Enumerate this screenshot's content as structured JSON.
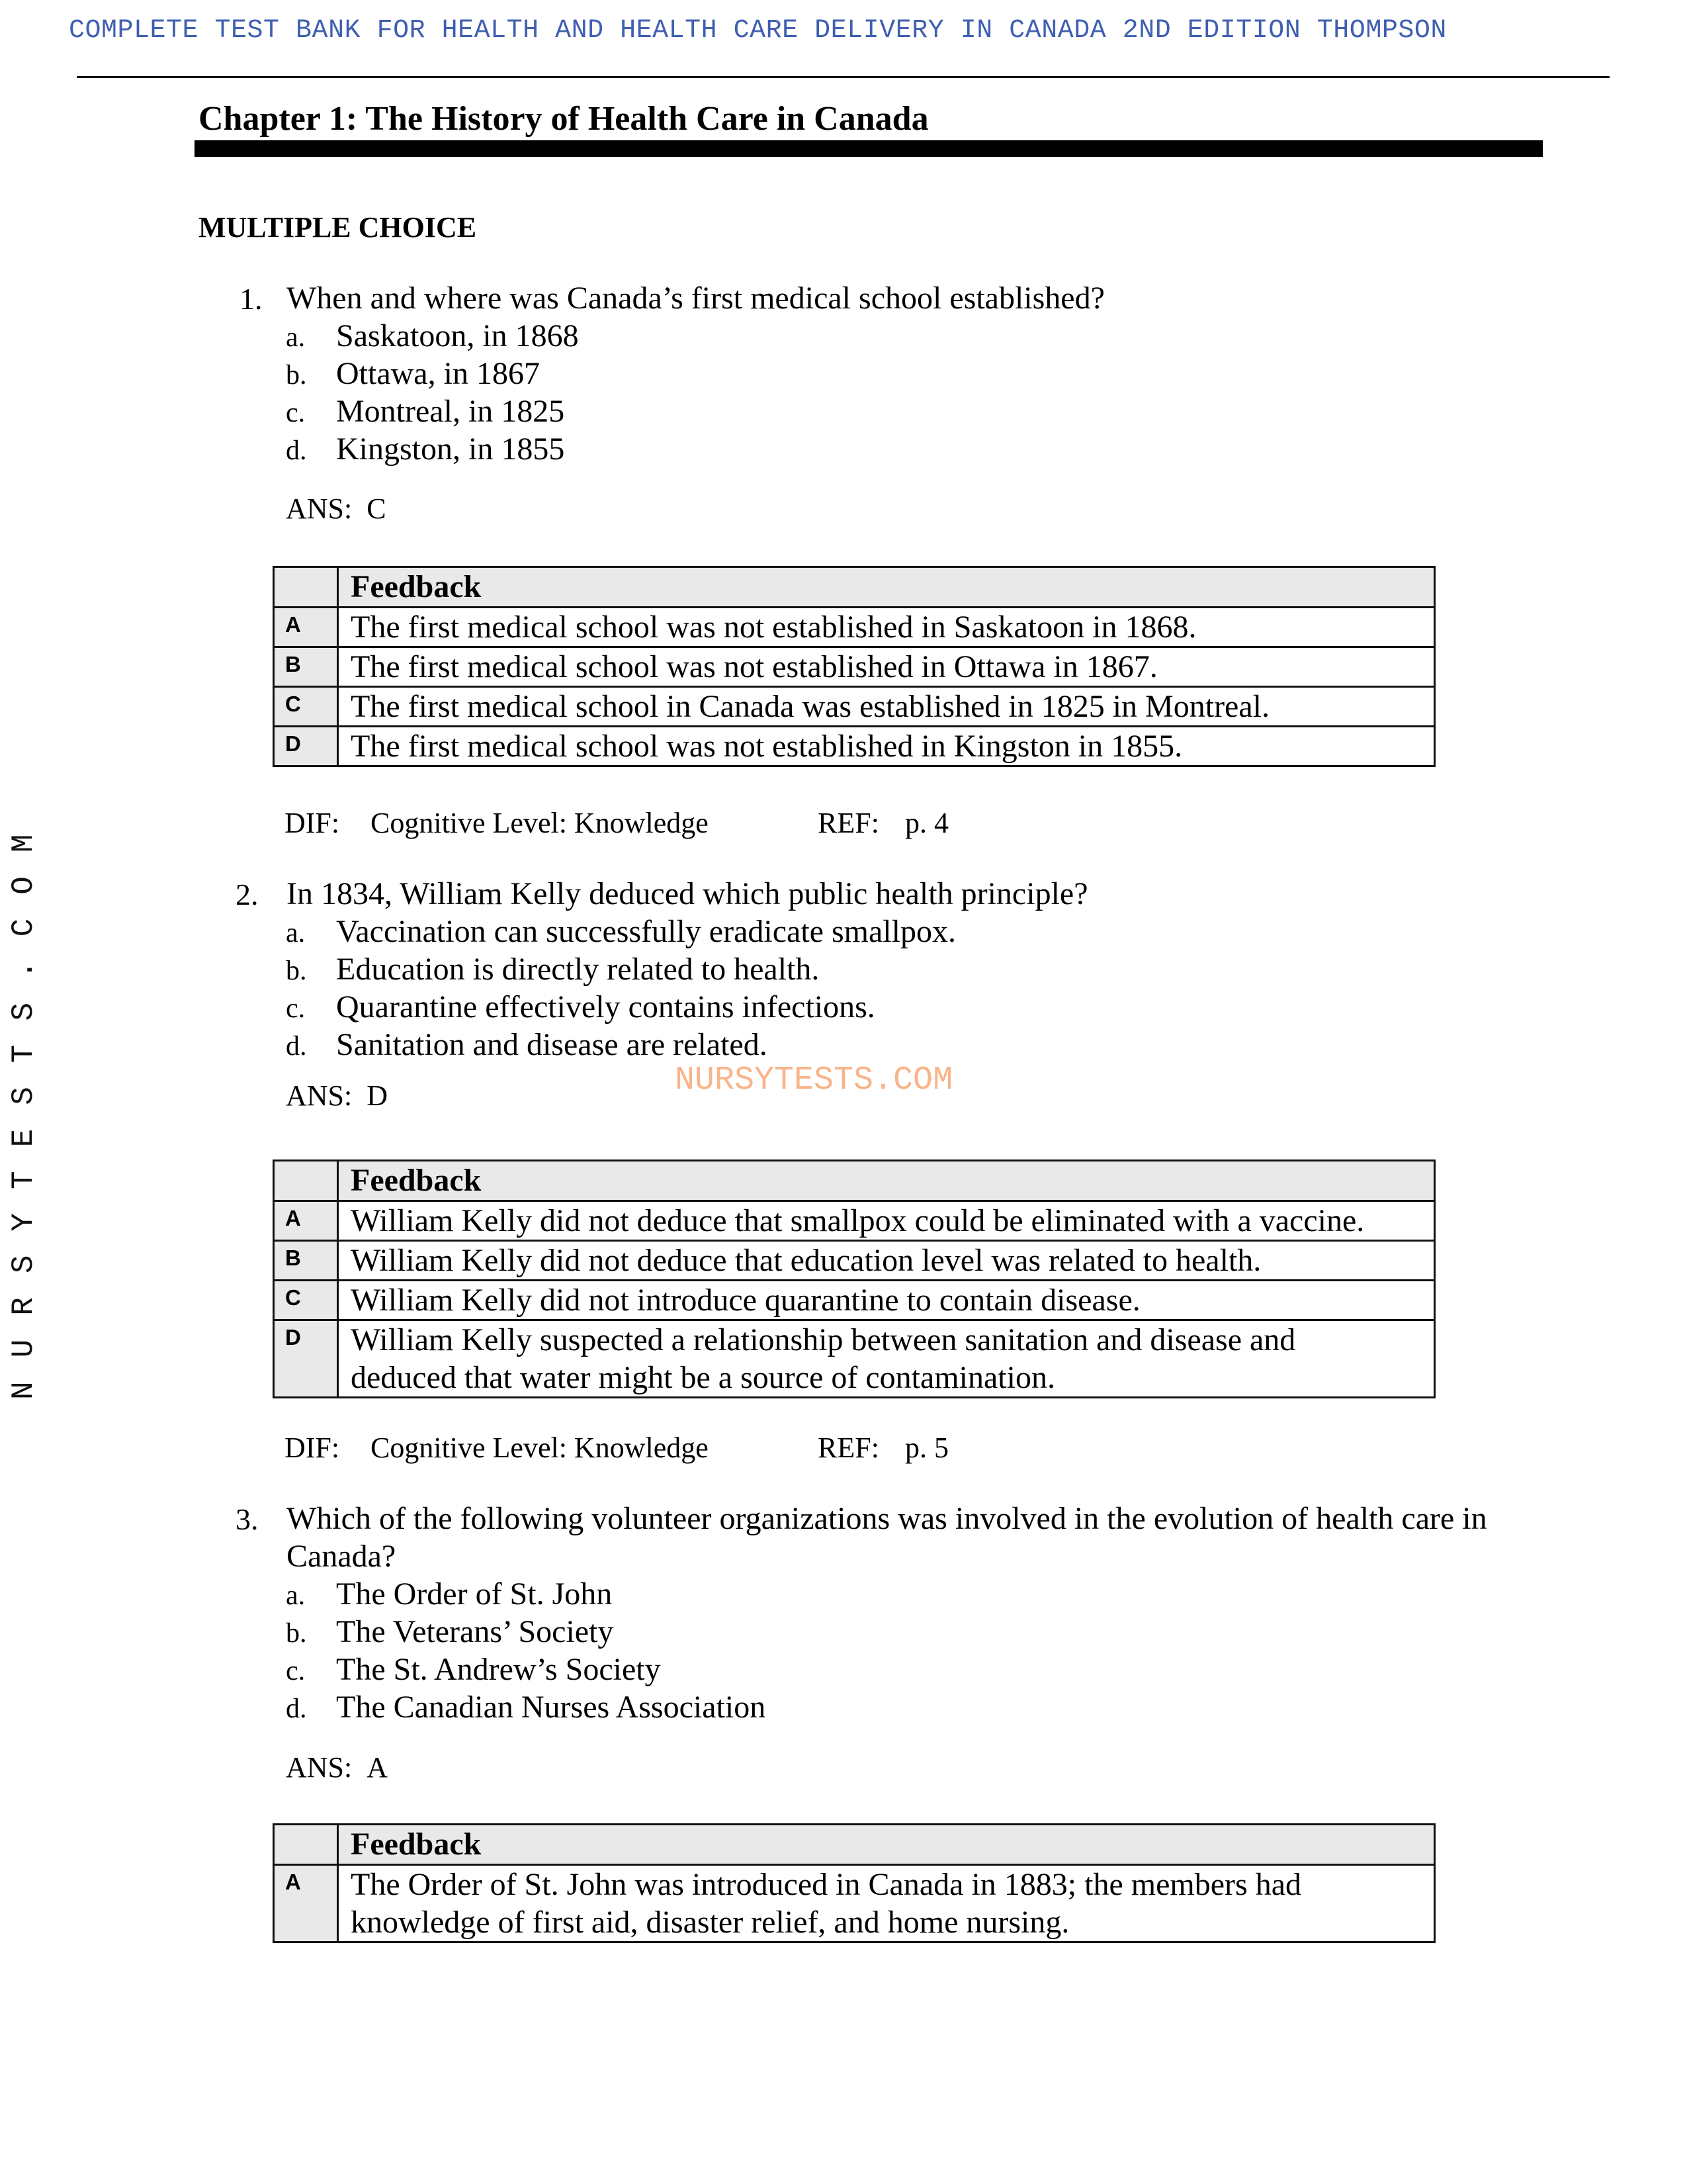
{
  "header": {
    "title": "COMPLETE TEST BANK FOR HEALTH AND HEALTH CARE DELIVERY IN CANADA 2ND EDITION THOMPSON",
    "color": "#3f5fb0"
  },
  "chapter_title": "Chapter 1: The History of Health Care in Canada",
  "section_title": "MULTIPLE CHOICE",
  "watermarks": {
    "center": "NURSYTESTS.COM",
    "center_color": "#f9b48a",
    "side": "NURSYTESTS.COM"
  },
  "questions": [
    {
      "number": "1.",
      "text": "When and where was Canada’s first medical school established?",
      "options": [
        {
          "letter": "a.",
          "text": "Saskatoon, in 1868"
        },
        {
          "letter": "b.",
          "text": "Ottawa, in 1867"
        },
        {
          "letter": "c.",
          "text": "Montreal, in 1825"
        },
        {
          "letter": "d.",
          "text": "Kingston, in 1855"
        }
      ],
      "answer_label": "ANS:",
      "answer": "C",
      "feedback_header": "Feedback",
      "feedback": [
        {
          "letter": "A",
          "text": "The first medical school was not established in Saskatoon in 1868."
        },
        {
          "letter": "B",
          "text": "The first medical school was not established in Ottawa in 1867."
        },
        {
          "letter": "C",
          "text": "The first medical school in Canada was established in 1825 in Montreal."
        },
        {
          "letter": "D",
          "text": "The first medical school was not established in Kingston in 1855."
        }
      ],
      "dif_label": "DIF:",
      "dif": "Cognitive Level: Knowledge",
      "ref_label": "REF:",
      "ref": "p. 4"
    },
    {
      "number": "2.",
      "text": "In 1834, William Kelly deduced which public health principle?",
      "options": [
        {
          "letter": "a.",
          "text": "Vaccination can successfully eradicate smallpox."
        },
        {
          "letter": "b.",
          "text": "Education is directly related to health."
        },
        {
          "letter": "c.",
          "text": "Quarantine effectively contains infections."
        },
        {
          "letter": "d.",
          "text": "Sanitation and disease are related."
        }
      ],
      "answer_label": "ANS:",
      "answer": "D",
      "feedback_header": "Feedback",
      "feedback": [
        {
          "letter": "A",
          "text": "William Kelly did not deduce that smallpox could be eliminated with a vaccine."
        },
        {
          "letter": "B",
          "text": "William Kelly did not deduce that education level was related to health."
        },
        {
          "letter": "C",
          "text": "William Kelly did not introduce quarantine to contain disease."
        },
        {
          "letter": "D",
          "text": "William Kelly suspected a relationship between sanitation and disease and deduced that water might be a source of contamination."
        }
      ],
      "dif_label": "DIF:",
      "dif": "Cognitive Level: Knowledge",
      "ref_label": "REF:",
      "ref": "p. 5"
    },
    {
      "number": "3.",
      "text_line1": "Which of the following volunteer organizations was involved in the evolution of health care in",
      "text_line2": "Canada?",
      "options": [
        {
          "letter": "a.",
          "text": "The Order of St. John"
        },
        {
          "letter": "b.",
          "text": "The Veterans’ Society"
        },
        {
          "letter": "c.",
          "text": "The St. Andrew’s Society"
        },
        {
          "letter": "d.",
          "text": "The Canadian Nurses Association"
        }
      ],
      "answer_label": "ANS:",
      "answer": "A",
      "feedback_header": "Feedback",
      "feedback": [
        {
          "letter": "A",
          "text": "The Order of St. John was introduced in Canada in 1883; the members had knowledge of first aid, disaster relief, and home nursing."
        }
      ]
    }
  ]
}
